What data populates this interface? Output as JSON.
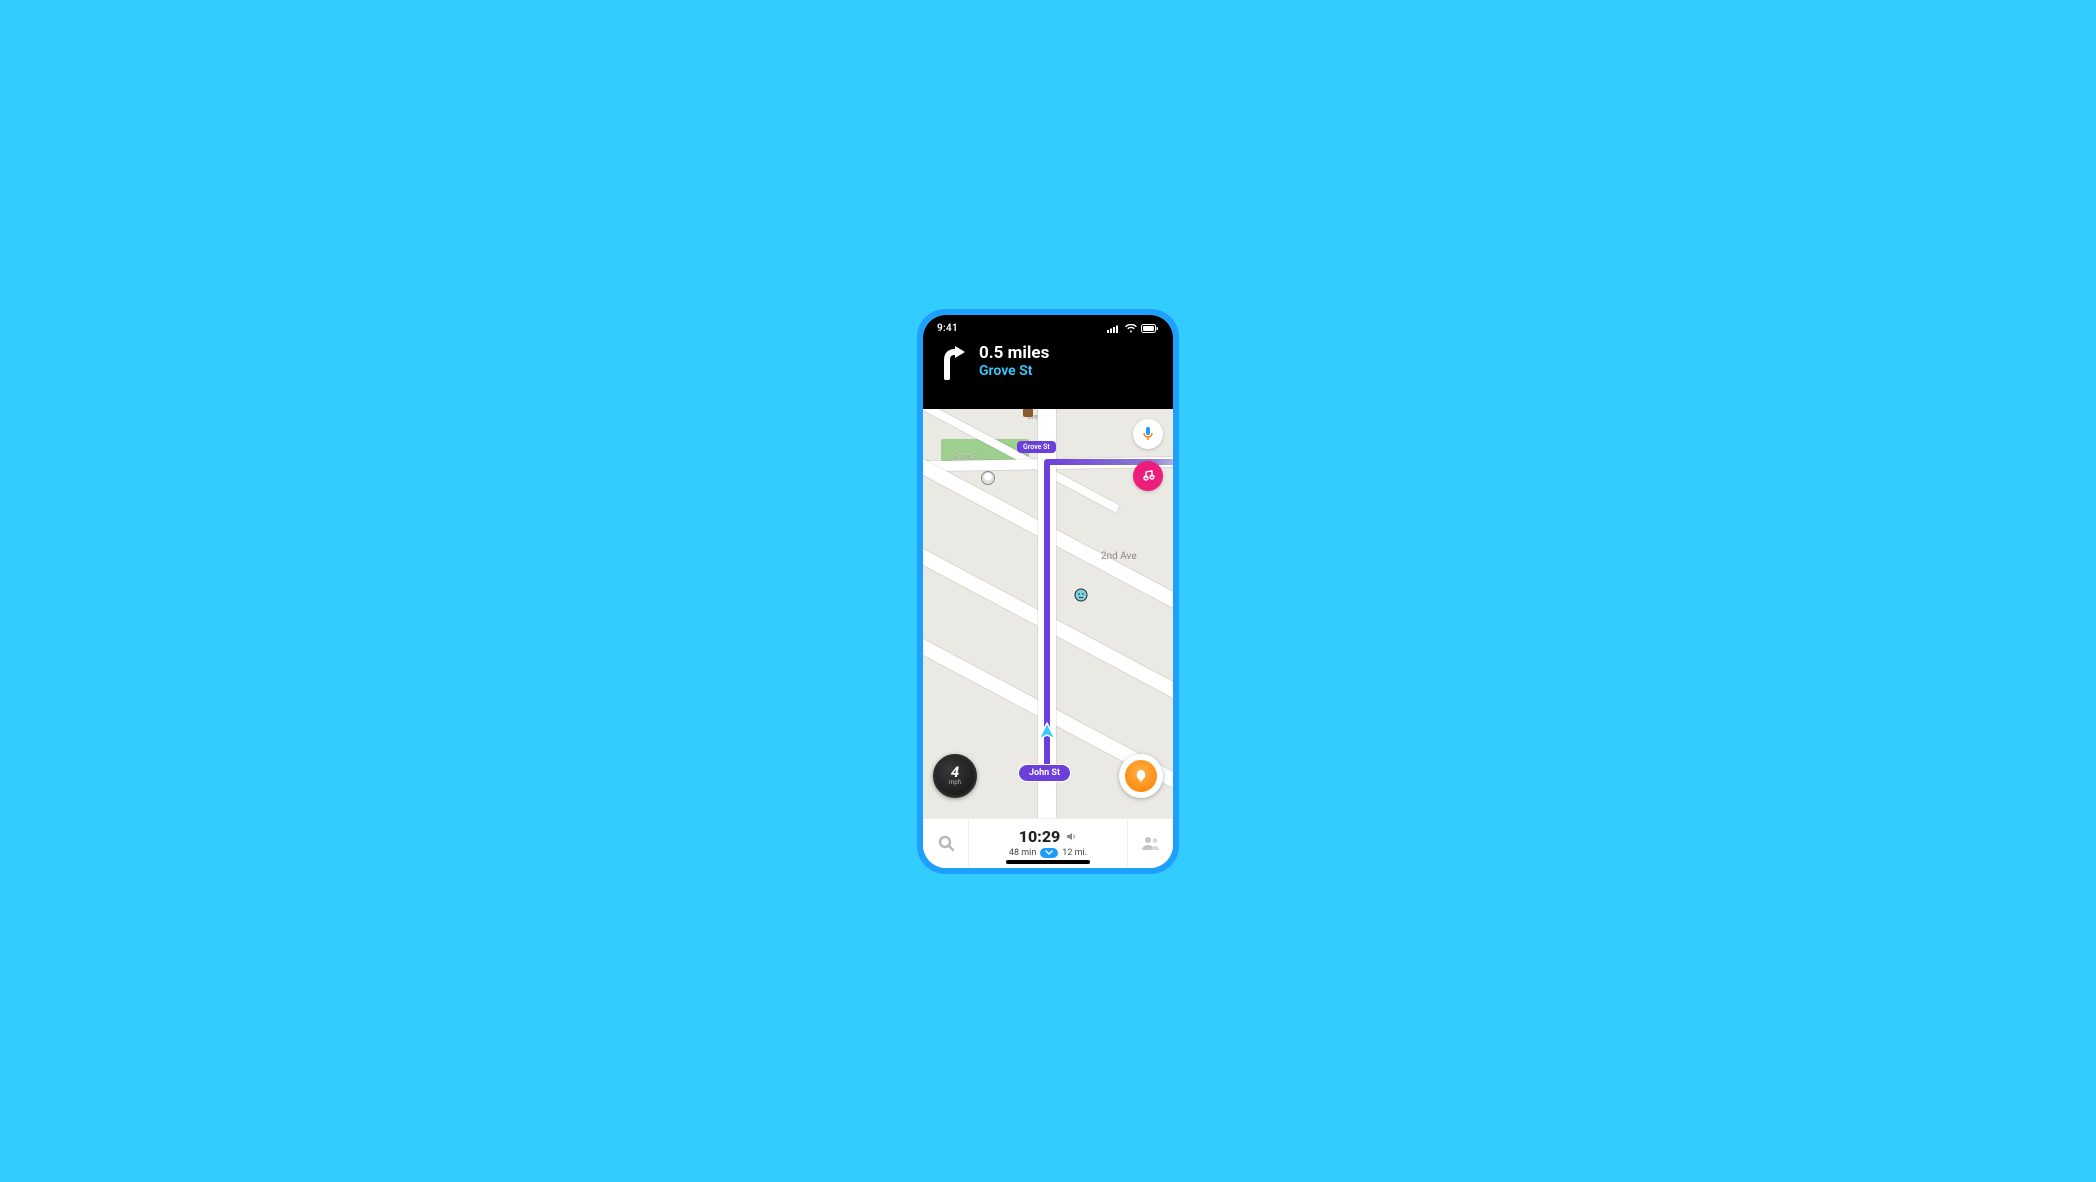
{
  "status": {
    "time": "9:41"
  },
  "nav": {
    "distance": "0.5 miles",
    "street": "Grove St"
  },
  "map": {
    "park_label": "Green Pl",
    "grove_label": "Grove St",
    "second_ave_label": "2nd Ave",
    "grove_bubble": "Grove St",
    "current_street": "John St"
  },
  "speed": {
    "value": "4",
    "unit": "mph"
  },
  "eta": {
    "arrival": "10:29",
    "duration": "48 min",
    "distance": "12 mi."
  }
}
